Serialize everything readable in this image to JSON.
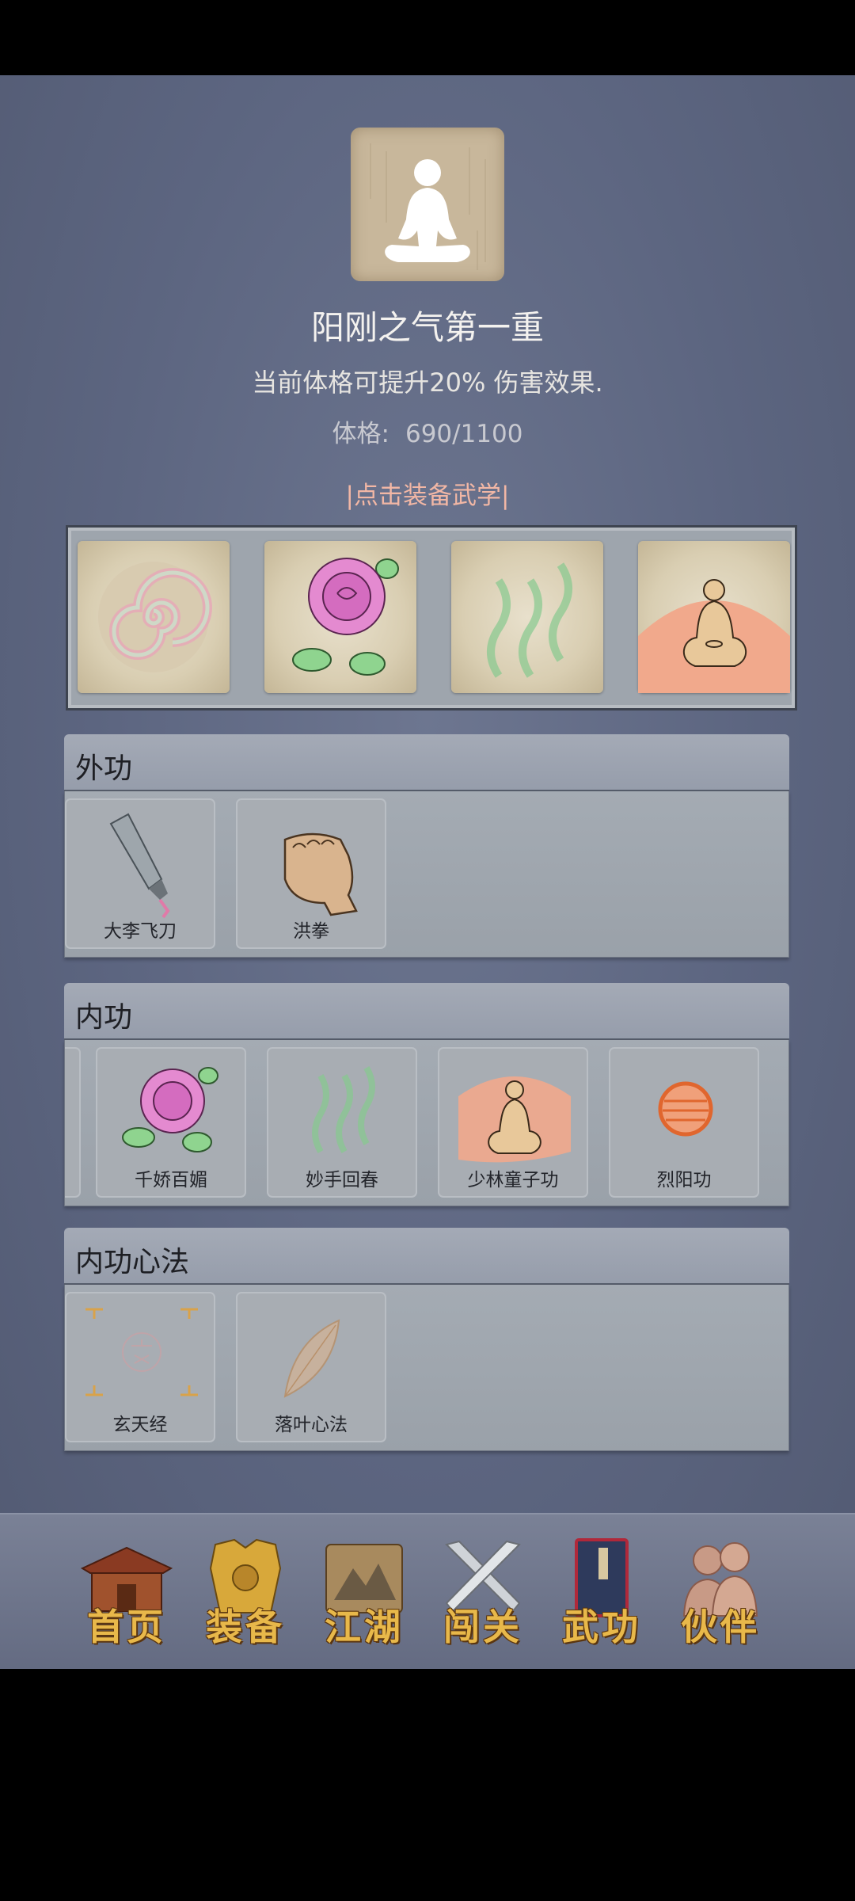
{
  "header": {
    "title": "阳刚之气第一重",
    "description": "当前体格可提升20% 伤害效果.",
    "stat_label": "体格:",
    "stat_value": "690/1100",
    "equip_link": "|点击装备武学|"
  },
  "equipped_slots": [
    {
      "icon": "spiral-swirl-icon"
    },
    {
      "icon": "rose-icon"
    },
    {
      "icon": "green-wisps-icon"
    },
    {
      "icon": "meditating-monk-icon"
    }
  ],
  "sections": {
    "outer": {
      "title": "外功",
      "items": [
        {
          "label": "大李飞刀",
          "icon": "flying-knife-icon"
        },
        {
          "label": "洪拳",
          "icon": "fist-icon"
        }
      ]
    },
    "inner": {
      "title": "内功",
      "items": [
        {
          "label": "千娇百媚",
          "icon": "rose-icon"
        },
        {
          "label": "妙手回春",
          "icon": "green-wisps-icon"
        },
        {
          "label": "少林童子功",
          "icon": "meditating-monk-icon"
        },
        {
          "label": "烈阳功",
          "icon": "sun-orb-icon"
        }
      ]
    },
    "mind": {
      "title": "内功心法",
      "items": [
        {
          "label": "玄天经",
          "icon": "xuan-scripture-icon"
        },
        {
          "label": "落叶心法",
          "icon": "falling-leaf-icon"
        }
      ]
    }
  },
  "nav": {
    "items": [
      {
        "label": "首页",
        "icon": "temple-icon"
      },
      {
        "label": "装备",
        "icon": "armor-icon"
      },
      {
        "label": "江湖",
        "icon": "scroll-map-icon"
      },
      {
        "label": "闯关",
        "icon": "crossed-swords-icon"
      },
      {
        "label": "武功",
        "icon": "martial-book-icon",
        "active": true
      },
      {
        "label": "伙伴",
        "icon": "companions-icon"
      }
    ]
  }
}
